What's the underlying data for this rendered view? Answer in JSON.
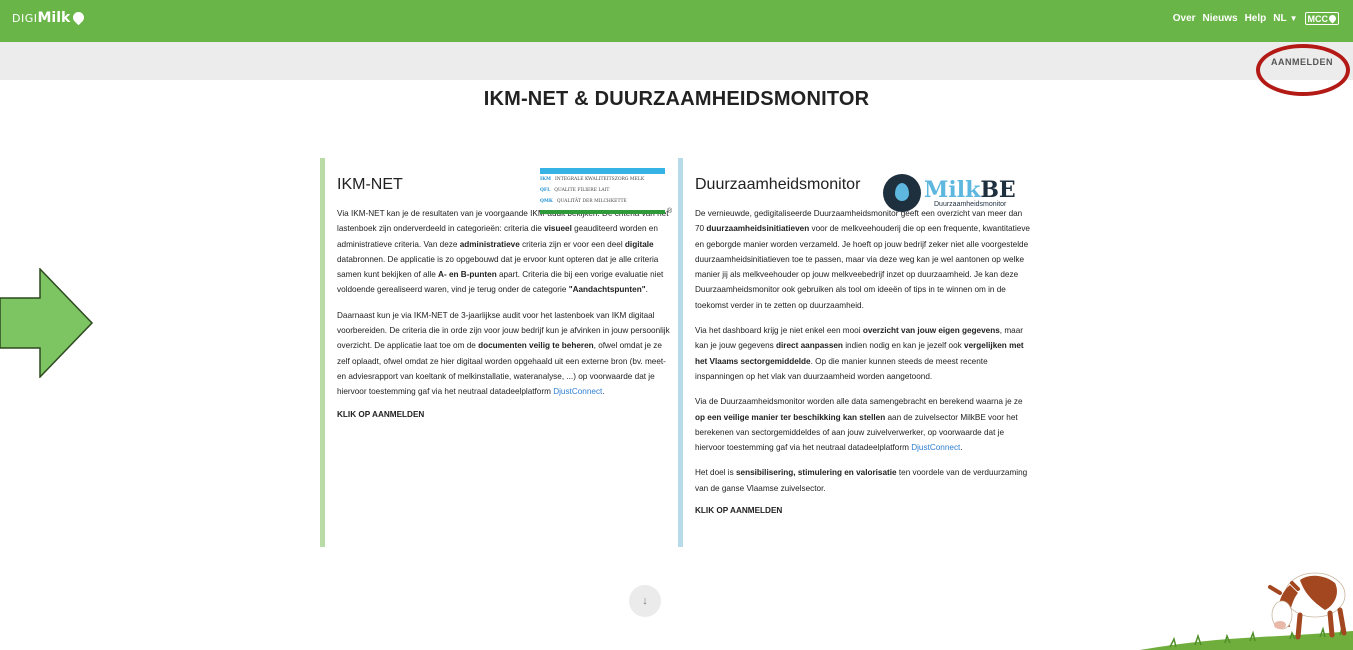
{
  "header": {
    "logo_prefix": "DIGI",
    "logo_main": "Milk",
    "nav": [
      "Over",
      "Nieuws",
      "Help"
    ],
    "language": "NL",
    "mcc_label": "MCC"
  },
  "subbar": {
    "login_label": "AANMELDEN"
  },
  "page": {
    "title": "IKM-NET & DUURZAAMHEIDSMONITOR"
  },
  "ikm_card": {
    "title": "IKM-NET",
    "logo_rows": [
      {
        "code": "IKM",
        "text": "INTEGRALE KWALITEITSZORG MELK"
      },
      {
        "code": "QFL",
        "text": "QUALITE FILIERE LAIT"
      },
      {
        "code": "QMK",
        "text": "QUALITÄT DER MILCHKETTE"
      }
    ],
    "logo_reg": "®",
    "p1": [
      "Via IKM-NET kan je de resultaten van je voorgaande IKM-audit bekijken. De criteria van het lastenboek zijn onderverdeeld in categorieën: criteria die ",
      "visueel",
      " geauditeerd worden en administratieve criteria. Van deze ",
      "administratieve",
      " criteria zijn er voor een deel ",
      "digitale",
      " databronnen. De applicatie is zo opgebouwd dat je ervoor kunt opteren dat je alle criteria samen kunt bekijken of alle ",
      "A- en B-punten",
      " apart. Criteria die bij een vorige evaluatie niet voldoende gerealiseerd waren, vind je terug onder de categorie ",
      "\"Aandachtspunten\"",
      "."
    ],
    "p2": [
      "Daarnaast kun je via IKM-NET de 3-jaarlijkse audit voor het lastenboek van IKM digitaal voorbereiden. De criteria die in orde zijn voor jouw bedrijf kun je afvinken in jouw persoonlijk overzicht. De applicatie laat toe om de ",
      "documenten veilig te beheren",
      ", ofwel omdat je ze zelf oplaadt, ofwel omdat ze hier digitaal worden opgehaald uit een externe bron (bv. meet-en adviesrapport van koeltank of melkinstallatie, wateranalyse, ...) op voorwaarde dat je hiervoor toestemming gaf via het neutraal datadeelplatform ",
      "DjustConnect",
      "."
    ],
    "cta": "KLIK OP AANMELDEN"
  },
  "duurzaam_card": {
    "title": "Duurzaamheidsmonitor",
    "logo_word_a": "Milk",
    "logo_word_b": "BE",
    "logo_sub": "Duurzaamheidsmonitor",
    "p1": [
      "De vernieuwde, gedigitaliseerde Duurzaamheidsmonitor geeft een overzicht van meer dan 70 ",
      "duurzaamheidsinitiatieven",
      " voor de melkveehouderij die op een frequente, kwantitatieve en geborgde manier worden verzameld. Je hoeft op jouw bedrijf zeker niet alle voorgestelde duurzaamheidsinitiatieven toe te passen, maar via deze weg kan je wel aantonen op welke manier jij als melkveehouder op jouw melkveebedrijf inzet op duurzaamheid. Je kan deze Duurzaamheidsmonitor ook gebruiken als tool om ideeën of tips in te winnen om in de toekomst verder in te zetten op duurzaamheid."
    ],
    "p2": [
      "Via het dashboard krijg je niet enkel een mooi ",
      "overzicht van jouw eigen gegevens",
      ", maar kan je jouw gegevens ",
      "direct aanpassen",
      " indien nodig en kan je jezelf ook ",
      "vergelijken met het Vlaams sectorgemiddelde",
      ". Op die manier kunnen steeds de meest recente inspanningen op het vlak van duurzaamheid worden aangetoond."
    ],
    "p3": [
      "Via de Duurzaamheidsmonitor worden alle data samengebracht en berekend waarna je ze ",
      "op een veilige manier ter beschikking kan stellen",
      " aan de zuivelsector MilkBE voor het berekenen van sectorgemiddeldes of aan jouw zuivelverwerker, op voorwaarde dat je hiervoor toestemming gaf via het neutraal datadeelplatform ",
      "DjustConnect",
      "."
    ],
    "p4": [
      "Het doel is ",
      "sensibilisering, stimulering en valorisatie",
      " ten voordele van de verduurzaming van de ganse Vlaamse zuivelsector."
    ],
    "cta": "KLIK OP AANMELDEN"
  },
  "scroll_icon": "↓",
  "colors": {
    "header_green": "#6ab547",
    "subbar_grey": "#ececec",
    "highlight_red": "#b31a16",
    "arrow_green": "#7dc463",
    "link_blue": "#2e7fd1"
  },
  "icons": [
    "arrow-right-icon",
    "drop-icon",
    "chevron-down-icon",
    "scroll-down-icon"
  ]
}
